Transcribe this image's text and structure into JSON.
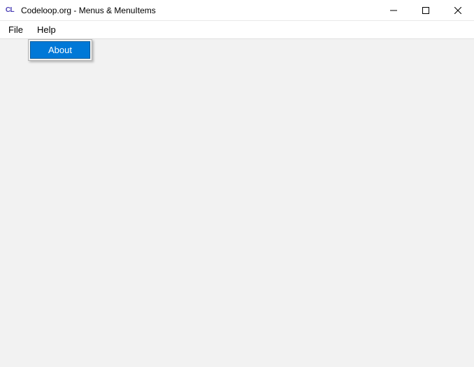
{
  "window": {
    "app_icon_text": "CL",
    "title": "Codeloop.org - Menus & MenuItems"
  },
  "menubar": {
    "items": [
      {
        "label": "File"
      },
      {
        "label": "Help"
      }
    ]
  },
  "dropdown": {
    "items": [
      {
        "label": "About",
        "highlighted": true
      }
    ]
  }
}
